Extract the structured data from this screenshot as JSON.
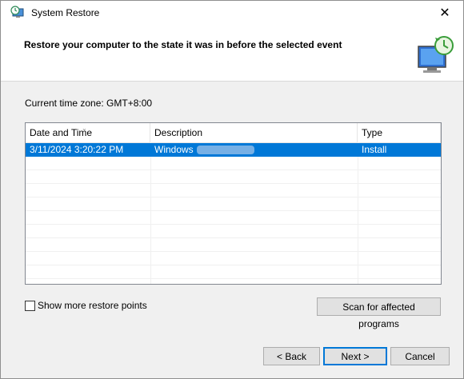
{
  "window": {
    "title": "System Restore",
    "close_glyph": "✕"
  },
  "header": {
    "text": "Restore your computer to the state it was in before the selected event"
  },
  "timezone": {
    "label": "Current time zone: GMT+8:00"
  },
  "table": {
    "columns": [
      "Date and Time",
      "Description",
      "Type"
    ],
    "rows": [
      {
        "date": "3/11/2024 3:20:22 PM",
        "description": "Windows",
        "type": "Install"
      }
    ]
  },
  "options": {
    "show_more_label": "Show more restore points",
    "show_more_checked": false
  },
  "buttons": {
    "scan": "Scan for affected programs",
    "back": "< Back",
    "next": "Next >",
    "cancel": "Cancel"
  },
  "colors": {
    "selection": "#0078d7",
    "dialog_bg": "#f0f0f0"
  }
}
